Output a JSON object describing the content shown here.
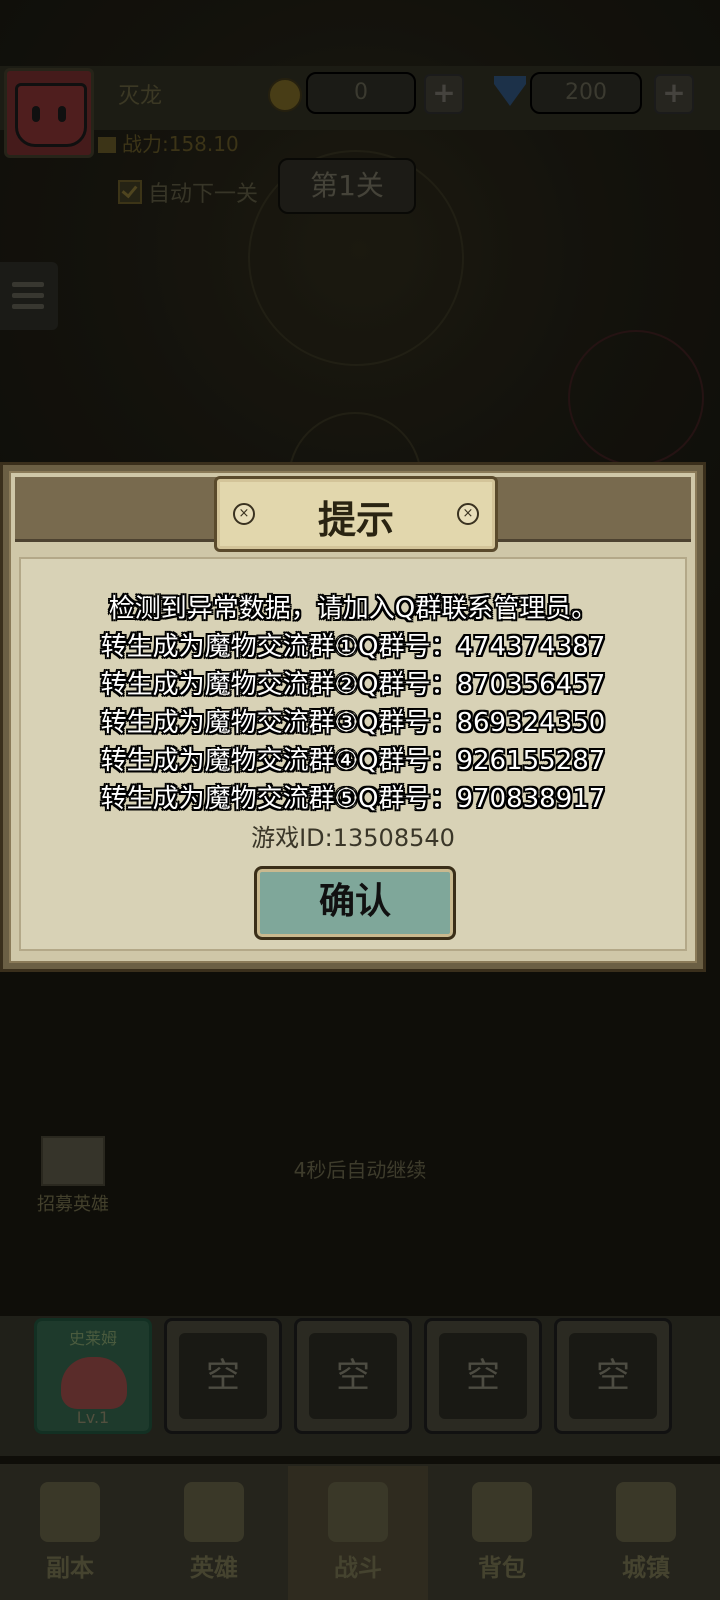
{
  "player": {
    "name": "灭龙",
    "gold": "0",
    "diamonds": "200",
    "power": "战力:158.10"
  },
  "stage": {
    "auto_next_label": "自动下一关",
    "current_stage": "第1关"
  },
  "dialog": {
    "title": "提示",
    "lines": [
      "检测到异常数据，请加入Q群联系管理员。",
      "转生成为魔物交流群①Q群号：474374387",
      "转生成为魔物交流群②Q群号：870356457",
      "转生成为魔物交流群③Q群号：869324350",
      "转生成为魔物交流群④Q群号：926155287",
      "转生成为魔物交流群⑤Q群号：970838917"
    ],
    "game_id": "游戏ID:13508540",
    "confirm_label": "确认"
  },
  "battle": {
    "countdown": "4秒后自动继续",
    "recruit_label": "招募英雄"
  },
  "team_slots": [
    {
      "name": "史莱姆",
      "level": "Lv.1"
    },
    {
      "label": "空"
    },
    {
      "label": "空"
    },
    {
      "label": "空"
    },
    {
      "label": "空"
    }
  ],
  "nav": {
    "tabs": [
      "副本",
      "英雄",
      "战斗",
      "背包",
      "城镇"
    ],
    "active": "战斗"
  }
}
